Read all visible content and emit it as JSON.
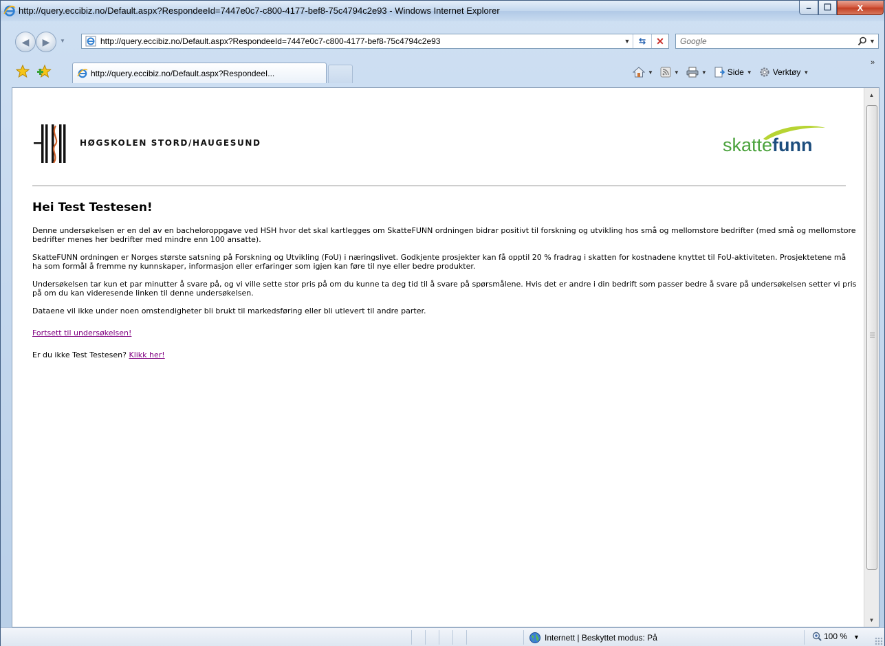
{
  "window": {
    "title": "http://query.eccibiz.no/Default.aspx?RespondeeId=7447e0c7-c800-4177-bef8-75c4794c2e93 - Windows Internet Explorer",
    "minimize_label": "–",
    "maximize_label": "☐",
    "close_label": "X"
  },
  "address_bar": {
    "url": "http://query.eccibiz.no/Default.aspx?RespondeeId=7447e0c7-c800-4177-bef8-75c4794c2e93"
  },
  "search": {
    "placeholder": "Google"
  },
  "tabs": [
    {
      "label": "http://query.eccibiz.no/Default.aspx?RespondeeI..."
    }
  ],
  "command_bar": {
    "page_label": "Side",
    "tools_label": "Verktøy"
  },
  "page": {
    "hsh_name": "HØGSKOLEN STORD/HAUGESUND",
    "skattefunn_light": "skatte",
    "skattefunn_bold": "funn",
    "heading": "Hei Test Testesen!",
    "paragraphs": [
      "Denne undersøkelsen er en del av en bacheloroppgave ved HSH hvor det skal kartlegges om SkatteFUNN ordningen bidrar positivt til forskning og utvikling hos små og mellomstore bedrifter (med små og mellomstore bedrifter menes her bedrifter med mindre enn 100 ansatte).",
      "SkatteFUNN ordningen er Norges største satsning på Forskning og Utvikling (FoU) i næringslivet. Godkjente prosjekter kan få opptil 20 % fradrag i skatten for kostnadene knyttet til FoU-aktiviteten. Prosjektetene må ha som formål å fremme ny kunnskaper, informasjon eller erfaringer som igjen kan føre til nye eller bedre produkter.",
      "Undersøkelsen tar kun et par minutter å svare på, og vi ville sette stor pris på om du kunne ta deg tid til å svare på spørsmålene. Hvis det er andre i din bedrift som passer bedre å svare på undersøkelsen setter vi pris på om du kan videresende linken til denne undersøkelsen.",
      "Dataene vil ikke under noen omstendigheter bli brukt til markedsføring eller bli utlevert til andre parter."
    ],
    "continue_link": "Fortsett til undersøkelsen!",
    "not_you_text": "Er du ikke Test Testesen?",
    "not_you_link": "Klikk her!"
  },
  "status_bar": {
    "zone": "Internett | Beskyttet modus: På",
    "zoom": "100 %"
  },
  "colors": {
    "link": "#800080",
    "skattefunn_green": "#4aa23c",
    "skattefunn_blue": "#1c4d7d",
    "hsh_orange": "#d2632b"
  }
}
